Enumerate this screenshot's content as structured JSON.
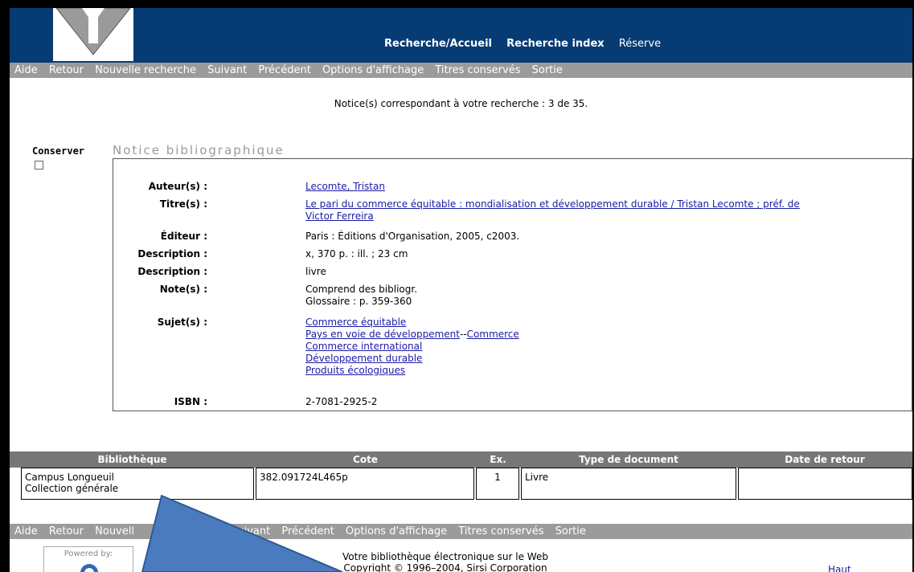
{
  "header": {
    "nav": [
      "Recherche/Accueil",
      "Recherche index",
      "Réserve"
    ]
  },
  "menu": [
    "Aide",
    "Retour",
    "Nouvelle recherche",
    "Suivant",
    "Précédent",
    "Options d'affichage",
    "Titres conservés",
    "Sortie"
  ],
  "menu_bottom_visible": [
    "Aide",
    "Retour",
    "Nouvell",
    "Suivant",
    "Précédent",
    "Options d'affichage",
    "Titres conservés",
    "Sortie"
  ],
  "result_count": "Notice(s) correspondant à votre recherche : 3 de 35.",
  "conserver_label": "Conserver",
  "section_title": "Notice bibliographique",
  "record": {
    "auteur_label": "Auteur(s) :",
    "auteur": "Lecomte, Tristan",
    "titre_label": "Titre(s) :",
    "titre_line1": "Le pari du commerce équitable : mondialisation et développement durable / Tristan Lecomte ; préf. de",
    "titre_line2": "Victor Ferreira",
    "editeur_label": "Éditeur :",
    "editeur": "Paris : Éditions d'Organisation, 2005, c2003.",
    "description1_label": "Description :",
    "description1": "x, 370 p. : ill. ; 23 cm",
    "description2_label": "Description :",
    "description2": "livre",
    "notes_label": "Note(s) :",
    "note1": "Comprend des bibliogr.",
    "note2": "Glossaire : p. 359-360",
    "sujets_label": "Sujet(s) :",
    "sujet1": "Commerce équitable",
    "sujet2a": "Pays en voie de développement",
    "sujet2sep": "--",
    "sujet2b": "Commerce",
    "sujet3": "Commerce international",
    "sujet4": "Développement durable",
    "sujet5": "Produits écologiques",
    "isbn_label": "ISBN :",
    "isbn": "2-7081-2925-2"
  },
  "holdings": {
    "headers": [
      "Bibliothèque",
      "Cote",
      "Ex.",
      "Type de document",
      "Date de retour"
    ],
    "row": {
      "bibliotheque_line1": "Campus Longueuil",
      "bibliotheque_line2": "Collection générale",
      "cote": "382.091724L465p",
      "ex": "1",
      "type": "Livre",
      "date": ""
    }
  },
  "footer": {
    "powered": "Powered by:",
    "line1": "Votre bibliothèque électronique sur le Web",
    "line2": "Copyright © 1996–2004, Sirsi Corporation",
    "top_link": "Haut"
  },
  "colors": {
    "header_bg": "#073b73",
    "menu_bg": "#9b9b9b",
    "link": "#1a1aa6",
    "arrow": "#4a7bbf"
  }
}
